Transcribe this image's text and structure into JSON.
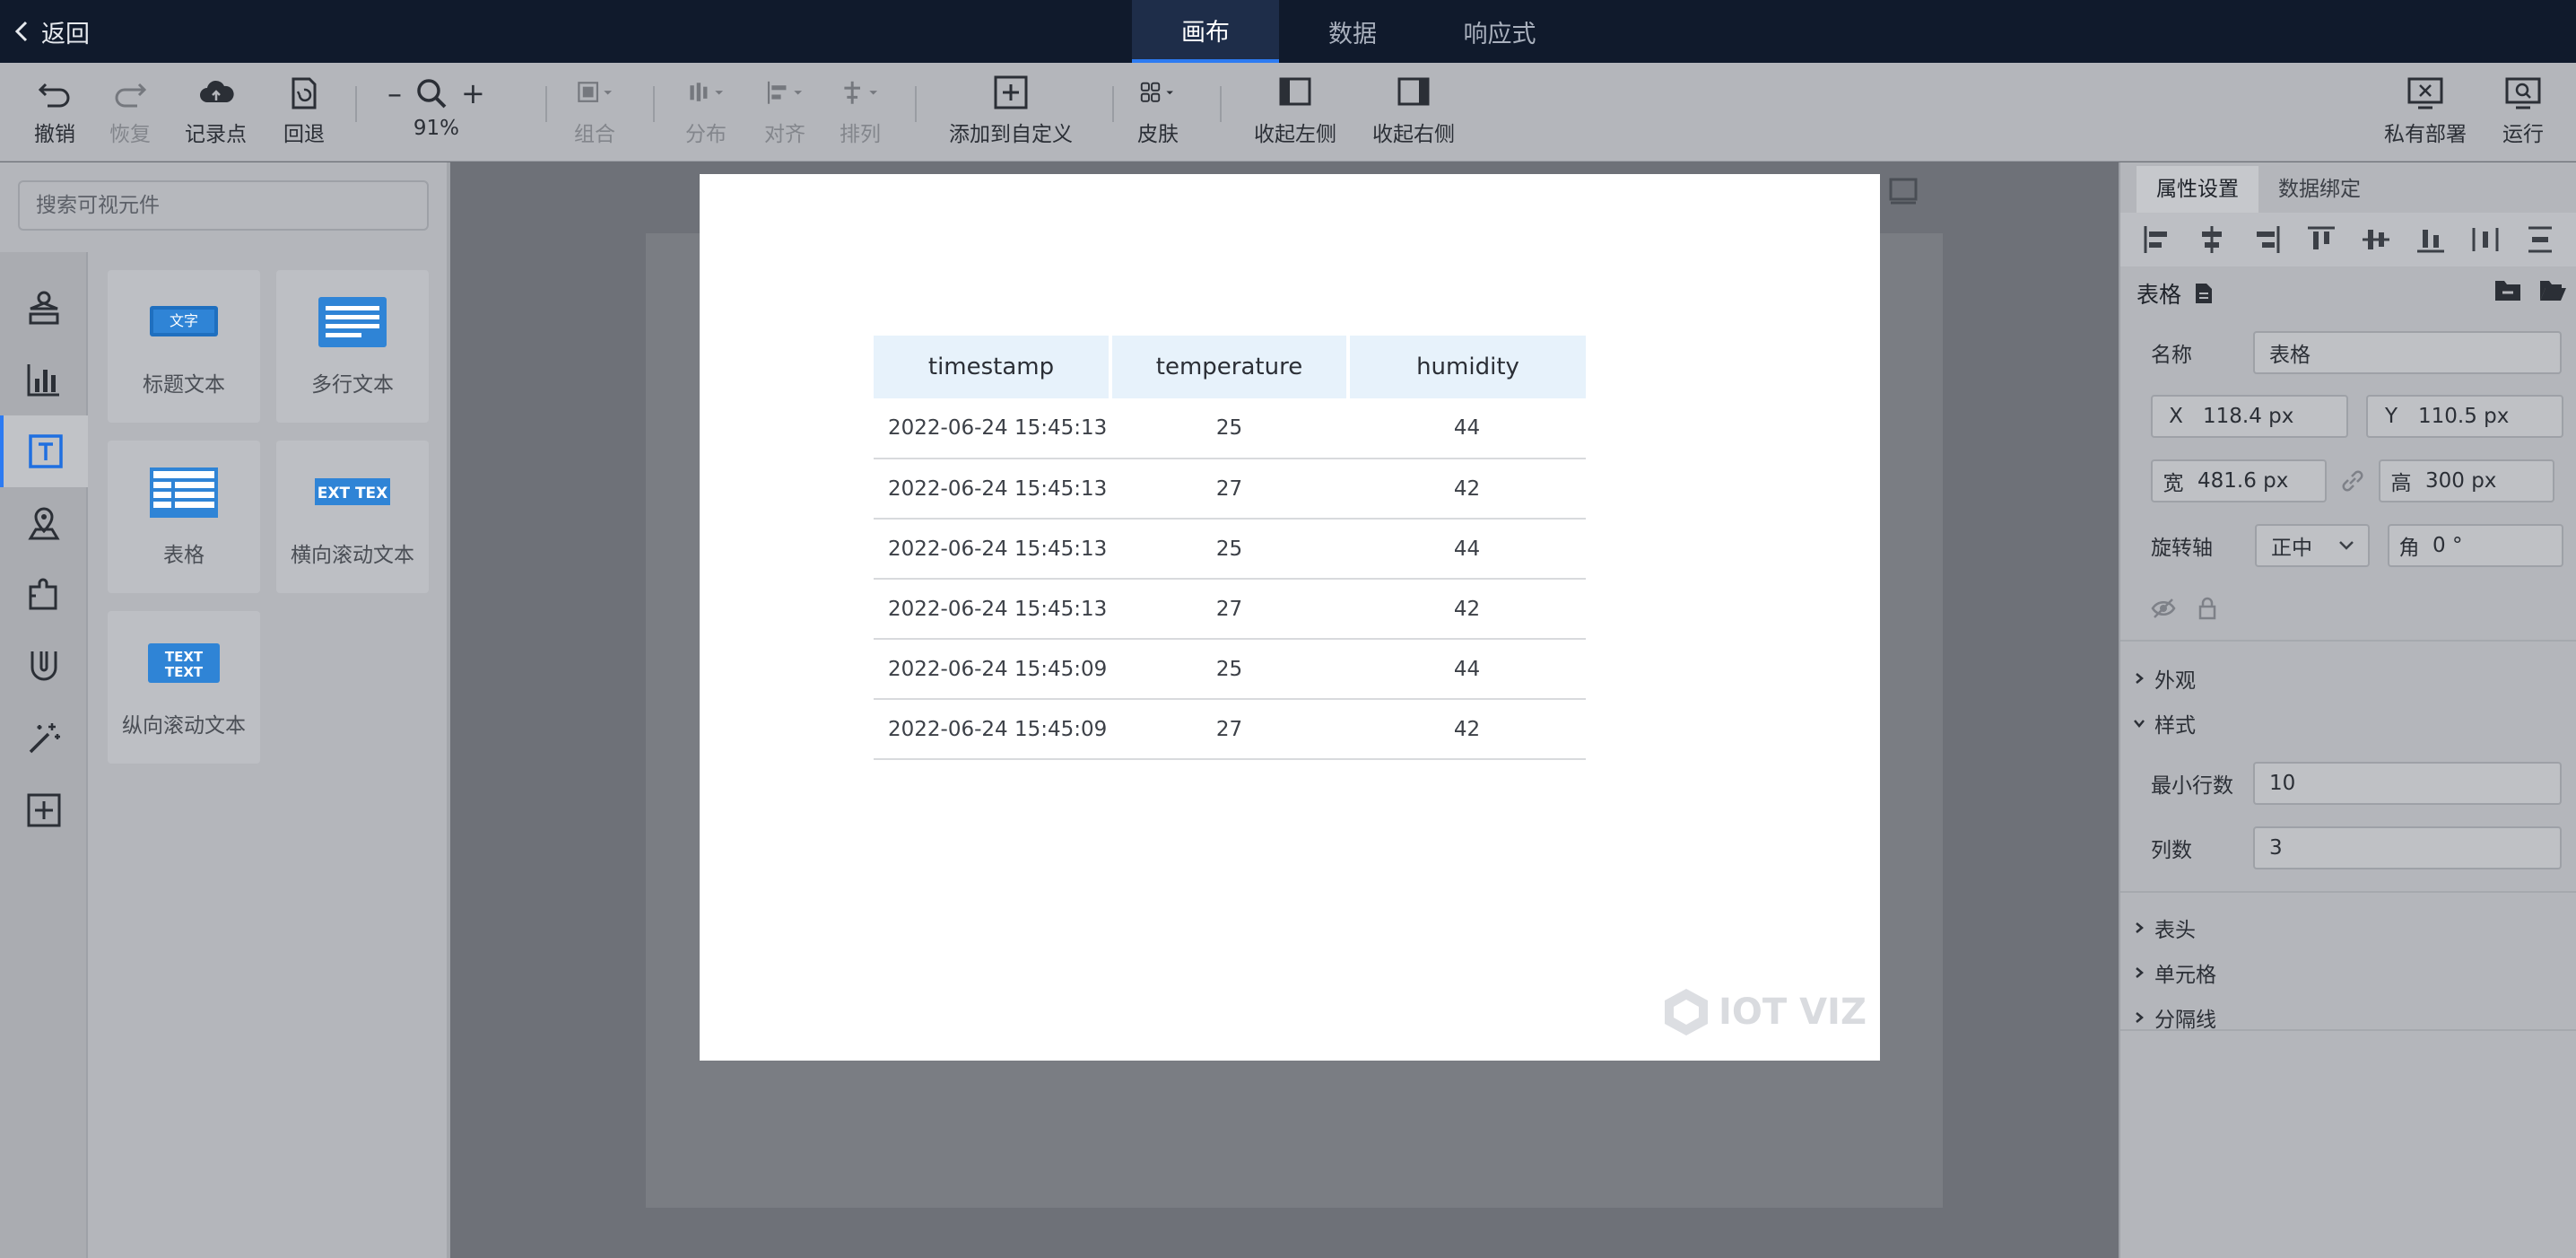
{
  "topbar": {
    "back_label": "返回",
    "tabs": [
      {
        "label": "画布"
      },
      {
        "label": "数据"
      },
      {
        "label": "响应式"
      }
    ]
  },
  "toolbar": {
    "undo": "撤销",
    "redo": "恢复",
    "record": "记录点",
    "rollback": "回退",
    "zoom_value": "91%",
    "group": "组合",
    "distribute": "分布",
    "align": "对齐",
    "arrange": "排列",
    "add_custom": "添加到自定义",
    "skin": "皮肤",
    "collapse_left": "收起左侧",
    "collapse_right": "收起右侧",
    "private_deploy": "私有部署",
    "run": "运行"
  },
  "left": {
    "search_placeholder": "搜索可视元件",
    "components": [
      {
        "label": "标题文本",
        "thumb_text": "文字"
      },
      {
        "label": "多行文本"
      },
      {
        "label": "表格"
      },
      {
        "label": "横向滚动文本",
        "thumb_text": "EXT TEX"
      },
      {
        "label": "纵向滚动文本",
        "thumb_text": "TEXT"
      }
    ]
  },
  "canvas": {
    "watermark": "IOT VIZ",
    "table": {
      "headers": [
        "timestamp",
        "temperature",
        "humidity"
      ],
      "rows": [
        [
          "2022-06-24 15:45:13",
          "25",
          "44"
        ],
        [
          "2022-06-24 15:45:13",
          "27",
          "42"
        ],
        [
          "2022-06-24 15:45:13",
          "25",
          "44"
        ],
        [
          "2022-06-24 15:45:13",
          "27",
          "42"
        ],
        [
          "2022-06-24 15:45:09",
          "25",
          "44"
        ],
        [
          "2022-06-24 15:45:09",
          "27",
          "42"
        ]
      ]
    }
  },
  "right": {
    "tabs": [
      {
        "label": "属性设置"
      },
      {
        "label": "数据绑定"
      }
    ],
    "section_title": "表格",
    "name_label": "名称",
    "name_value": "表格",
    "x_label": "X",
    "x_value": "118.4 px",
    "y_label": "Y",
    "y_value": "110.5 px",
    "w_label": "宽",
    "w_value": "481.6 px",
    "h_label": "高",
    "h_value": "300 px",
    "rotate_label": "旋转轴",
    "rotate_value": "正中",
    "angle_label": "角",
    "angle_value": "0 °",
    "appearance": "外观",
    "style": "样式",
    "min_rows_label": "最小行数",
    "min_rows_value": "10",
    "cols_label": "列数",
    "cols_value": "3",
    "header": "表头",
    "cell": "单元格",
    "divider": "分隔线"
  }
}
